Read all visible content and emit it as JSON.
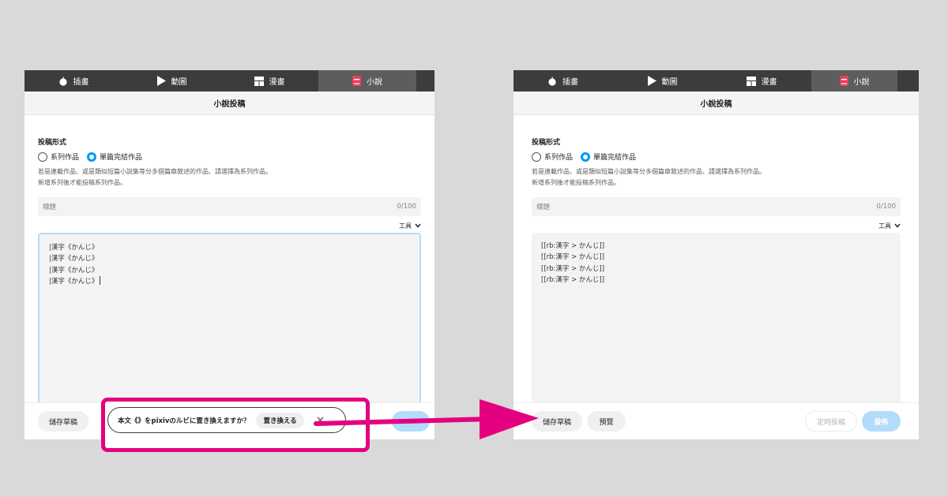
{
  "left_panel": {
    "tabs": [
      {
        "label": "插畫",
        "icon": "apple-icon"
      },
      {
        "label": "動圖",
        "icon": "play-icon"
      },
      {
        "label": "漫畫",
        "icon": "manga-grid-icon"
      },
      {
        "label": "小說",
        "icon": "book-icon",
        "active": true
      }
    ],
    "header_title": "小說投稿",
    "post_format_label": "投稿形式",
    "radio_series": "系列作品",
    "radio_single": "單篇完結作品",
    "note_line1": "若是連載作品、或是類似短篇小說集等分多個篇章敘述的作品、請選擇為系列作品。",
    "note_line2": "新增系列後才能投稿系列作品。",
    "title_placeholder": "標題",
    "title_counter": "0/100",
    "tools_label": "工具",
    "editor_lines": [
      "|漢字《かんじ》",
      "|漢字《かんじ》",
      "|漢字《かんじ》",
      "|漢字《かんじ》"
    ],
    "save_draft": "儲存草稿"
  },
  "toast": {
    "message": "本文《》をpixivのルビに置き換えますか？",
    "replace_button": "置き換える"
  },
  "right_panel": {
    "tabs": [
      {
        "label": "插畫",
        "icon": "apple-icon"
      },
      {
        "label": "動圖",
        "icon": "play-icon"
      },
      {
        "label": "漫畫",
        "icon": "manga-grid-icon"
      },
      {
        "label": "小說",
        "icon": "book-icon",
        "active": true
      }
    ],
    "header_title": "小說投稿",
    "post_format_label": "投稿形式",
    "radio_series": "系列作品",
    "radio_single": "單篇完結作品",
    "note_line1": "若是連載作品、或是類似短篇小說集等分多個篇章敘述的作品、請選擇為系列作品。",
    "note_line2": "新增系列後才能投稿系列作品。",
    "title_placeholder": "標題",
    "title_counter": "0/100",
    "tools_label": "工具",
    "editor_lines": [
      "[[rb:漢字 > かんじ]]",
      "[[rb:漢字 > かんじ]]",
      "[[rb:漢字 > かんじ]]",
      "[[rb:漢字 > かんじ]]"
    ],
    "save_draft": "儲存草稿",
    "preview": "預覽",
    "schedule": "定時投稿",
    "publish": "發佈"
  },
  "colors": {
    "highlight": "#e4007f",
    "accent_blue": "#0096fa",
    "book_icon_red": "#e8425d"
  }
}
